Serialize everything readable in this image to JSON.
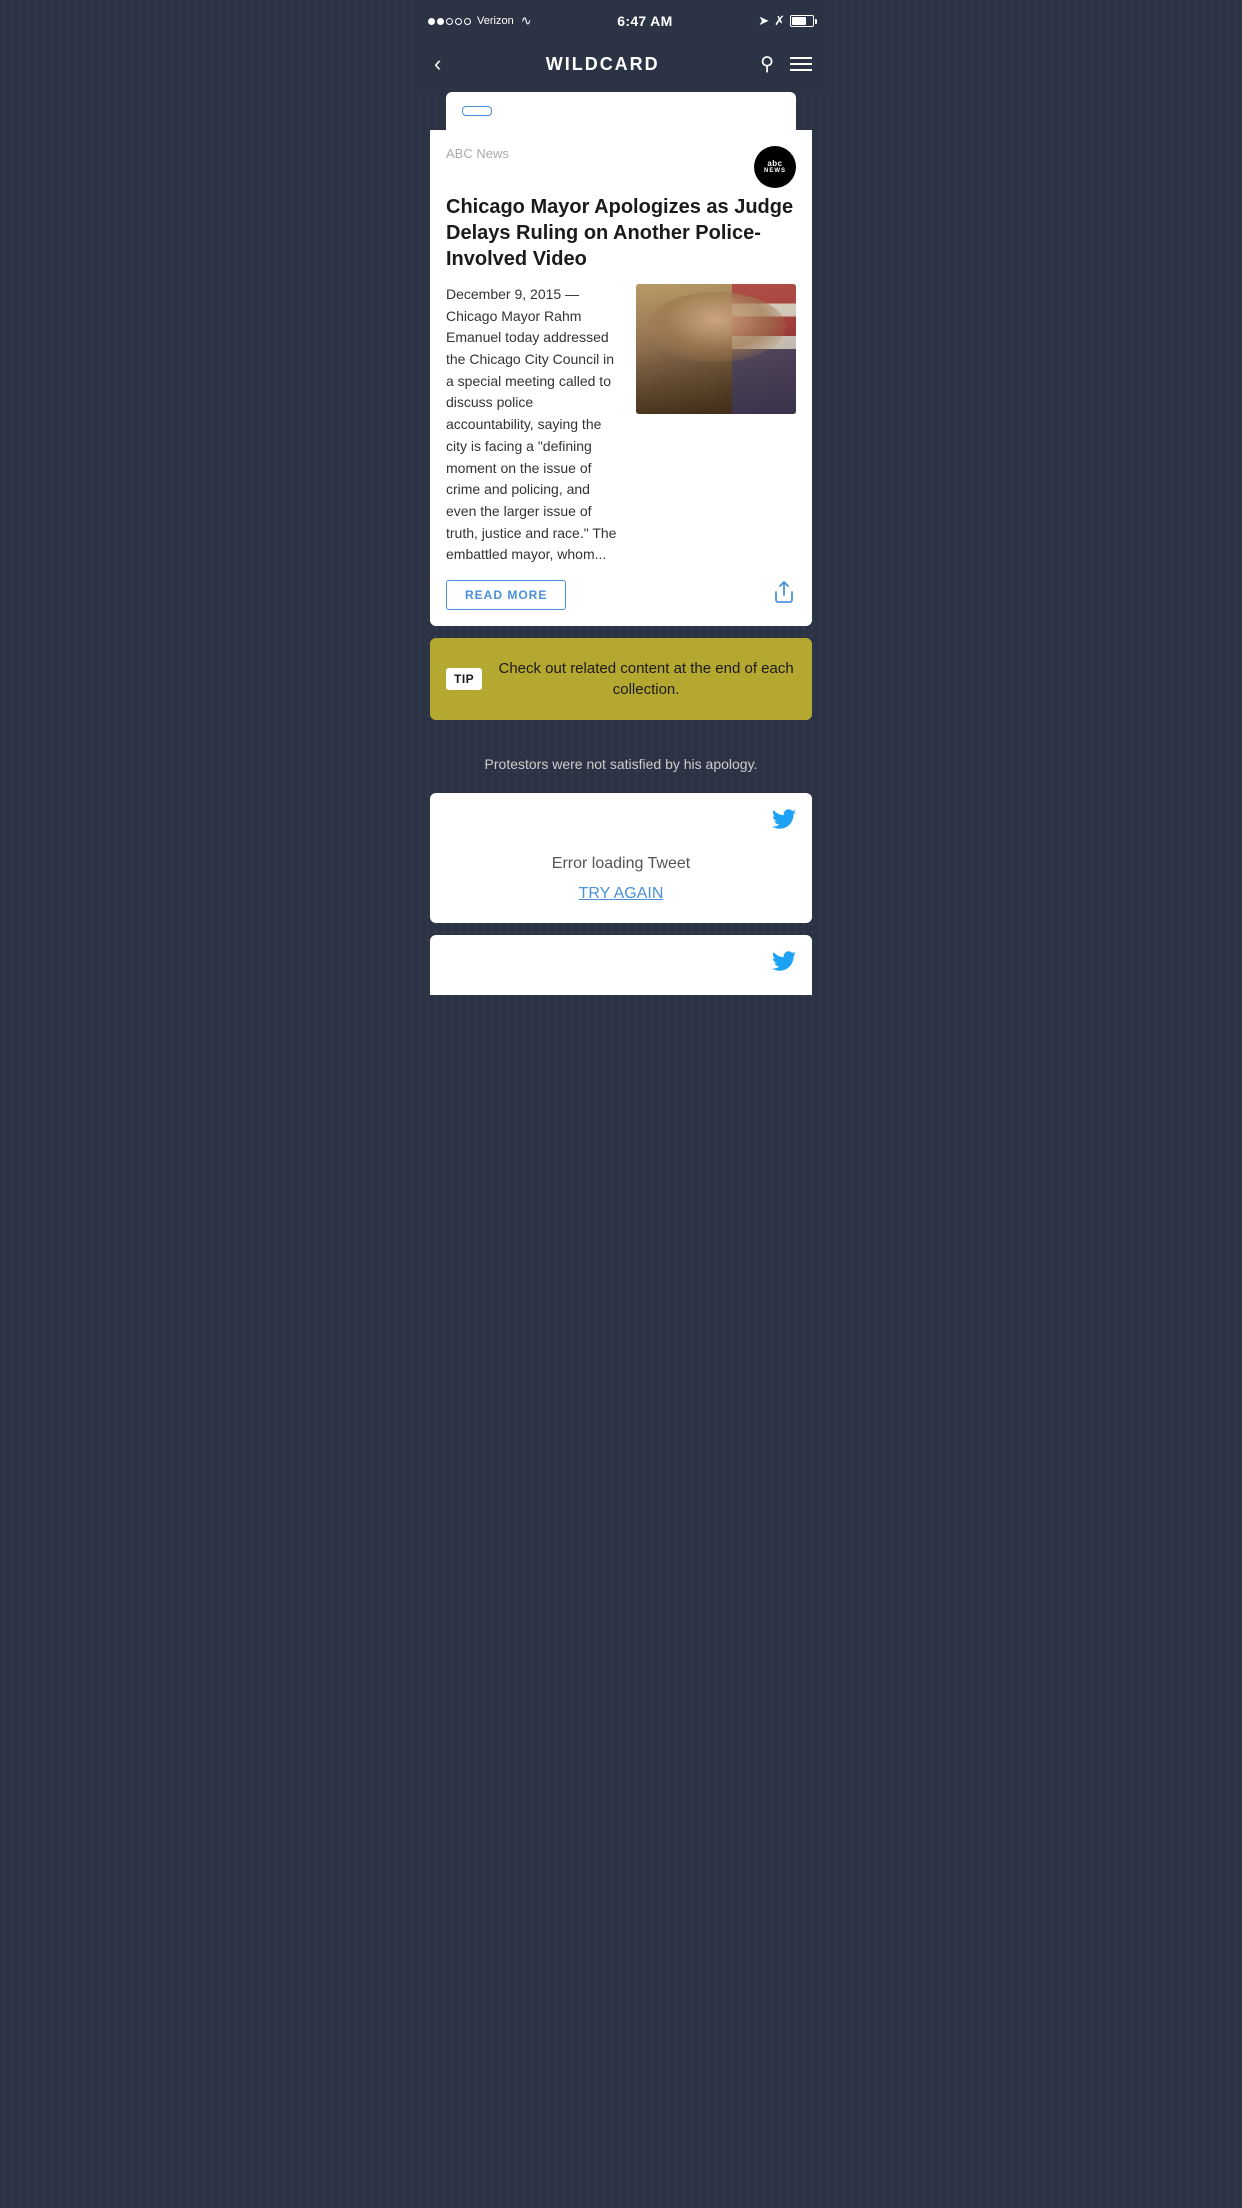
{
  "statusBar": {
    "carrier": "Verizon",
    "time": "6:47 AM",
    "signalDots": [
      true,
      true,
      false,
      false,
      false
    ],
    "batteryLevel": 70
  },
  "navBar": {
    "title": "WILDCARD",
    "backLabel": "‹"
  },
  "topBar": {
    "buttonLabel": ""
  },
  "newsCard": {
    "source": "ABC News",
    "logoText": "abc",
    "logoSubtext": "NEWS",
    "headline": "Chicago Mayor Apologizes as Judge Delays Ruling on Another Police-Involved Video",
    "date": "December 9, 2015 —",
    "bodyText": "Chicago Mayor Rahm Emanuel today addressed the Chicago City Council in a special meeting called to discuss police accountability, saying the city is facing a \"defining moment on the issue of crime and policing, and even the larger issue of truth, justice and race.\" The embattled mayor, whom...",
    "readMoreLabel": "READ MORE"
  },
  "tipBanner": {
    "badgeLabel": "TIP",
    "tipText": "Check out related content at the end of each collection."
  },
  "protestText": "Protestors were not satisfied by his apology.",
  "tweetCard": {
    "errorText": "Error loading Tweet",
    "tryAgainLabel": "TRY AGAIN"
  },
  "tweetCardPartial": {
    "visible": true
  }
}
